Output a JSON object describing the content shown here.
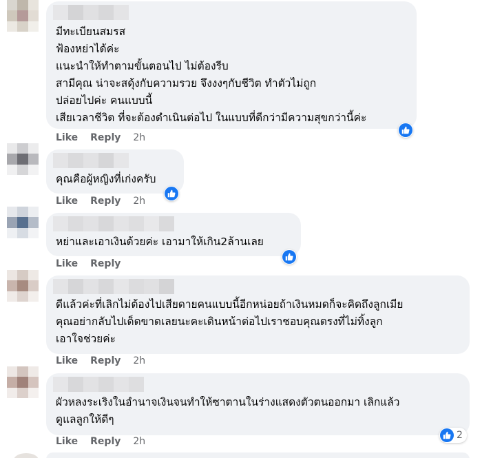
{
  "colors": {
    "bubble": "#f0f2f5",
    "like_blue": "#1877f2",
    "meta_gray": "#65676b",
    "text": "#050505"
  },
  "icons": {
    "reaction": "thumbs-up-icon"
  },
  "comments": [
    {
      "lines": [
        "มีทะเบียนสมรส",
        "ฟ้องหย่าได้ค่ะ",
        "แนะนำให้ทำตามขั้นตอนไป ไม่ต้องรีบ",
        "สามีคุณ น่าจะสดุ้งกับความรวย จึงงงๆกับชีวิต ทำตัวไม่ถูก",
        "ปล่อยไปค่ะ คนแบบนี้",
        "เสียเวลาชีวิต ที่จะต้องดำเนินต่อไป ในแบบที่ดีกว่ามีความสุขกว่านี้ค่ะ"
      ],
      "like": "Like",
      "reply": "Reply",
      "time": "2h",
      "reaction_count": ""
    },
    {
      "lines": [
        "คุณคือผู้หญิงที่เก่งครับ"
      ],
      "like": "Like",
      "reply": "Reply",
      "time": "2h",
      "reaction_count": ""
    },
    {
      "lines": [
        "หย่าและเอาเงินด้วยค่ะ เอามาให้เกิน2ล้านเลย"
      ],
      "like": "Like",
      "reply": "Reply",
      "time": "",
      "reaction_count": ""
    },
    {
      "lines": [
        "ดีแล้วค่ะที่เลิกไม่ต้องไปเสียดายคนแบบนี้อีกหน่อยถ้าเงินหมดก็จะคิดถึงลูกเมีย",
        "คุณอย่ากลับไปเด็ดขาดเลยนะคะเดินหน้าต่อไปเราชอบคุณตรงที่ไม่ทิ้งลูก",
        "เอาใจช่วยค่ะ"
      ],
      "like": "Like",
      "reply": "Reply",
      "time": "2h",
      "reaction_count": ""
    },
    {
      "lines": [
        "ผัวหลงระเริงในอำนาจเงินจนทำให้ซาตานในร่างแสดงตัวตนออกมา เลิกแล้ว",
        "ดูแลลูกให้ดีๆ"
      ],
      "like": "Like",
      "reply": "Reply",
      "time": "2h",
      "reaction_count": "2"
    }
  ]
}
